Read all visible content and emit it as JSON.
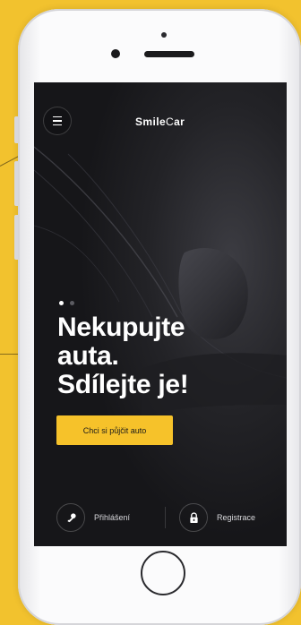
{
  "app": {
    "brand_prefix": "Smile",
    "brand_glyph": "C",
    "brand_suffix": "ar"
  },
  "hero": {
    "slide_index": 1,
    "slide_count": 2,
    "headline_lines": [
      "Nekupujte",
      "auta.",
      "Sdílejte je!"
    ],
    "cta_label": "Chci si půjčit auto"
  },
  "auth": {
    "login_label": "Přihlášení",
    "register_label": "Registrace"
  },
  "icons": {
    "menu": "hamburger-menu-icon",
    "login": "key-icon",
    "register": "lock-icon"
  },
  "colors": {
    "accent": "#f6c22a",
    "screen_bg": "#19191c",
    "page_bg": "#f2c22e"
  }
}
